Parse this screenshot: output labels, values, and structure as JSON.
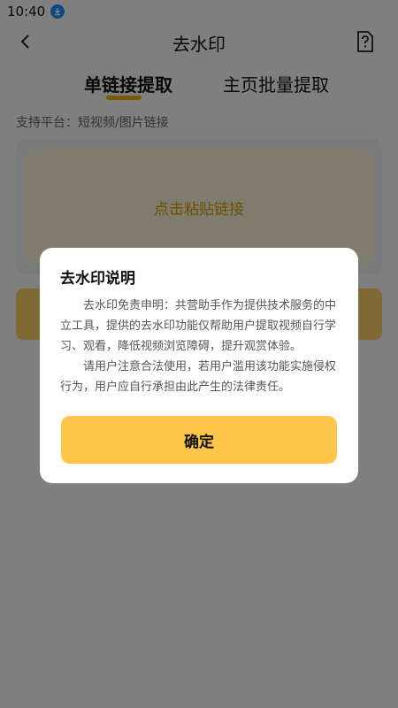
{
  "status_bar": {
    "time": "10:40"
  },
  "header": {
    "title": "去水印"
  },
  "tabs": [
    {
      "label": "单链接提取",
      "active": true
    },
    {
      "label": "主页批量提取",
      "active": false
    }
  ],
  "platform_hint": "支持平台：短视频/图片链接",
  "paste_area": {
    "label": "点击粘贴链接"
  },
  "dialog": {
    "title": "去水印说明",
    "paragraphs": [
      "去水印免责申明：共营助手作为提供技术服务的中立工具，提供的去水印功能仅帮助用户提取视频自行学习、观看，降低视频浏览障碍，提升观赏体验。",
      "请用户注意合法使用，若用户滥用该功能实施侵权行为，用户应自行承担由此产生的法律责任。"
    ],
    "confirm_label": "确定"
  },
  "colors": {
    "accent": "#f2b500",
    "confirm_button": "#ffc64a",
    "overlay": "rgba(0,0,0,0.5)"
  }
}
